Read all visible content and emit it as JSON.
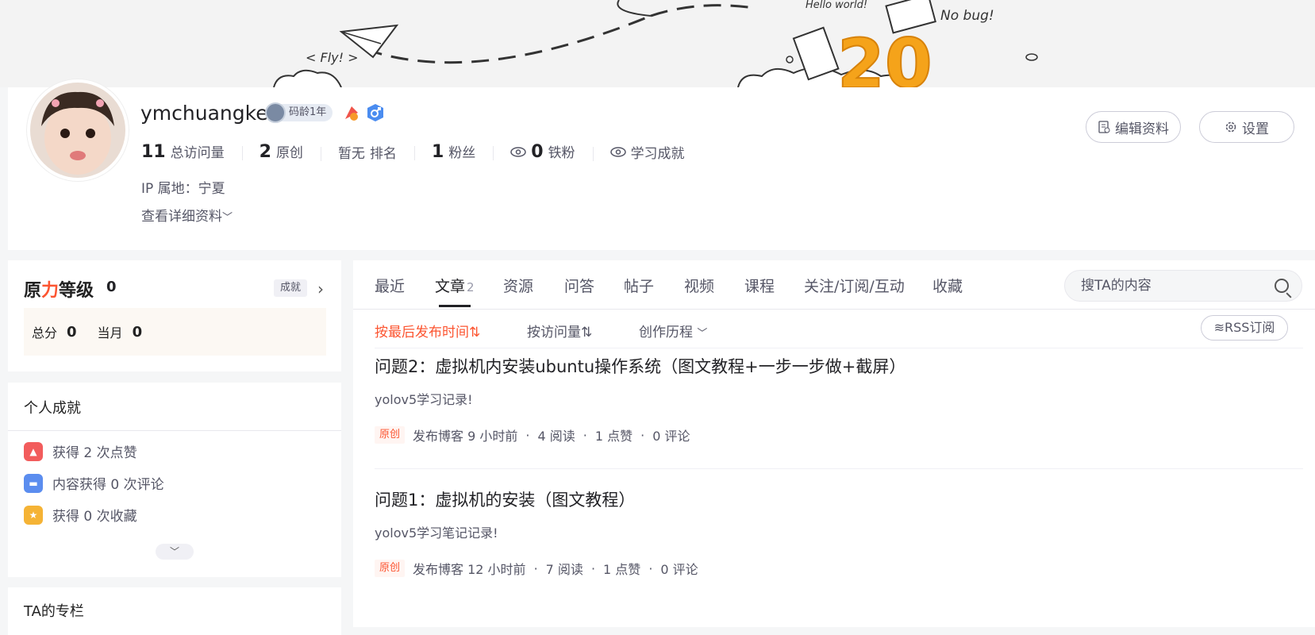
{
  "banner": {
    "fly_text": "< Fly! >",
    "nobug_text": "No bug!",
    "hello_text": "Hello world!",
    "big_number": "20"
  },
  "profile": {
    "username": "ymchuangke",
    "code_age": "码龄1年",
    "stats": [
      {
        "num": "11",
        "label": "总访问量"
      },
      {
        "num": "2",
        "label": "原创"
      },
      {
        "num": "暂无",
        "label": "排名"
      },
      {
        "num": "1",
        "label": "粉丝"
      },
      {
        "num": "0",
        "label": "铁粉"
      }
    ],
    "achievement_link": "学习成就",
    "ip": "IP 属地：宁夏",
    "detail_link": "查看详细资料",
    "edit_button": "编辑资料",
    "settings_button": "设置"
  },
  "level": {
    "title_prefix": "原",
    "title_red": "力",
    "title_suffix": "等级",
    "value": "0",
    "chengjiu": "成就",
    "total_label": "总分",
    "total_value": "0",
    "month_label": "当月",
    "month_value": "0"
  },
  "achievements": {
    "title": "个人成就",
    "items": [
      {
        "text": "获得 2 次点赞",
        "color": "#f25c5c"
      },
      {
        "text": "内容获得 0 次评论",
        "color": "#5b8def"
      },
      {
        "text": "获得 0 次收藏",
        "color": "#f5b335"
      }
    ]
  },
  "columns": {
    "title": "TA的专栏"
  },
  "tabs": [
    {
      "label": "最近"
    },
    {
      "label": "文章",
      "count": "2",
      "active": true
    },
    {
      "label": "资源"
    },
    {
      "label": "问答"
    },
    {
      "label": "帖子"
    },
    {
      "label": "视频"
    },
    {
      "label": "课程"
    },
    {
      "label": "关注/订阅/互动"
    },
    {
      "label": "收藏"
    }
  ],
  "search": {
    "placeholder": "搜TA的内容"
  },
  "sort": {
    "latest": "按最后发布时间",
    "visits": "按访问量",
    "history": "创作历程",
    "rss": "RSS订阅"
  },
  "articles": [
    {
      "title": "问题2：虚拟机内安装ubuntu操作系统（图文教程+一步一步做+截屏）",
      "desc": "yolov5学习记录!",
      "tag": "原创",
      "published": "发布博客 9 小时前",
      "reads": "4 阅读",
      "likes": "1 点赞",
      "comments": "0 评论"
    },
    {
      "title": "问题1：虚拟机的安装（图文教程）",
      "desc": "yolov5学习笔记记录!",
      "tag": "原创",
      "published": "发布博客 12 小时前",
      "reads": "7 阅读",
      "likes": "1 点赞",
      "comments": "0 评论"
    }
  ],
  "colors": {
    "accent": "#fc5531",
    "text": "#222226",
    "muted": "#555666"
  }
}
